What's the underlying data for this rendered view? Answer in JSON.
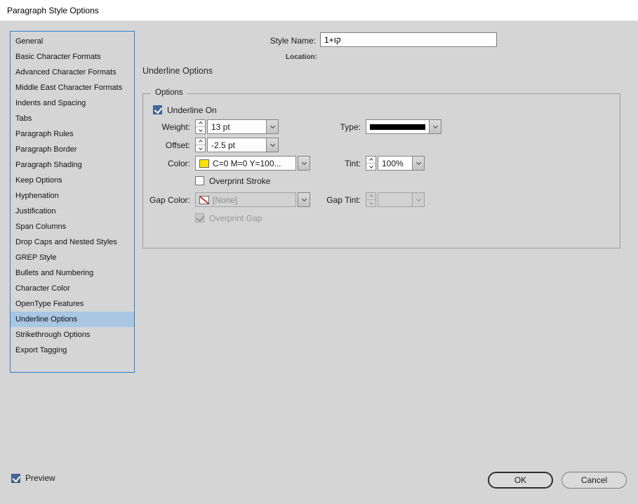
{
  "window": {
    "title": "Paragraph Style Options"
  },
  "sidebar": {
    "items": [
      "General",
      "Basic Character Formats",
      "Advanced Character Formats",
      "Middle East Character Formats",
      "Indents and Spacing",
      "Tabs",
      "Paragraph Rules",
      "Paragraph Border",
      "Paragraph Shading",
      "Keep Options",
      "Hyphenation",
      "Justification",
      "Span Columns",
      "Drop Caps and Nested Styles",
      "GREP Style",
      "Bullets and Numbering",
      "Character Color",
      "OpenType Features",
      "Underline Options",
      "Strikethrough Options",
      "Export Tagging"
    ],
    "selected": "Underline Options"
  },
  "header": {
    "style_name_label": "Style Name:",
    "style_name_value": "1+קו",
    "location_label": "Location:"
  },
  "panel": {
    "title": "Underline Options",
    "group_label": "Options",
    "underline_on": "Underline On",
    "weight_label": "Weight:",
    "weight_value": "13 pt",
    "type_label": "Type:",
    "offset_label": "Offset:",
    "offset_value": "-2.5 pt",
    "color_label": "Color:",
    "color_value": "C=0 M=0 Y=100...",
    "color_swatch_hex": "#f6e500",
    "tint_label": "Tint:",
    "tint_value": "100%",
    "overprint_stroke": "Overprint Stroke",
    "gap_color_label": "Gap Color:",
    "gap_color_value": "[None]",
    "gap_tint_label": "Gap Tint:",
    "overprint_gap": "Overprint Gap"
  },
  "footer": {
    "preview": "Preview",
    "ok": "OK",
    "cancel": "Cancel"
  },
  "colors": {
    "selection": "#a9c6e2",
    "sidebar_border": "#2b7cd3",
    "checkbox_checked": "#44679b",
    "line_swatch": "#000000",
    "none_swatch_red": "#cf2127"
  }
}
